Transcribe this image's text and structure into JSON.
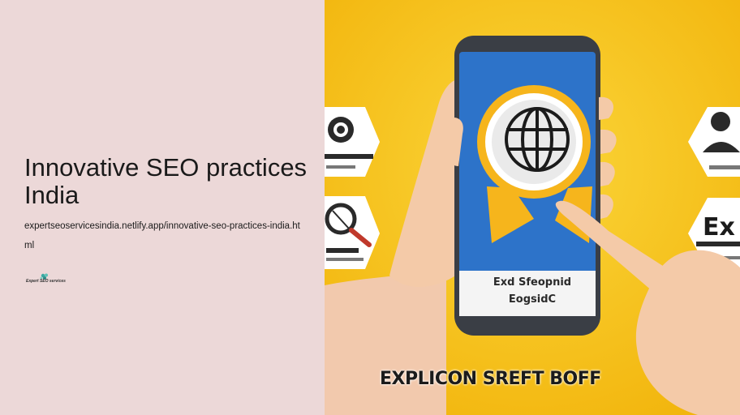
{
  "page": {
    "title": "Innovative SEO practices India",
    "url": "expertseoservicesindia.netlify.app/innovative-seo-practices-india.html"
  },
  "logo": {
    "text": "Expert SEO services",
    "icon": "cluster-logo-icon"
  },
  "hero": {
    "caption": "EXPLICON SREFT BOFF",
    "screen_text_line1": "Exd Sfeopnid",
    "screen_text_line2": "EogsidC",
    "badge_icon": "globe-icon",
    "right_card_text": "Ex",
    "colors": {
      "background": "#f6c21a",
      "screen": "#2d73c9",
      "badge": "#f6b51c",
      "left_panel": "#ecd8d8"
    }
  }
}
